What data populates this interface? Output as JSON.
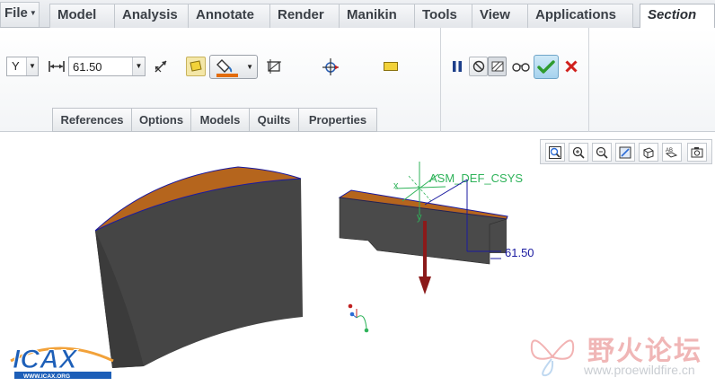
{
  "menu": {
    "file_label": "File",
    "tabs": [
      "Model",
      "Analysis",
      "Annotate",
      "Render",
      "Manikin",
      "Tools",
      "View",
      "Applications"
    ],
    "active_tab": "Section"
  },
  "ribbon": {
    "direction_value": "Y",
    "offset_value": "61.50",
    "subtabs": [
      "References",
      "Options",
      "Models",
      "Quilts",
      "Properties"
    ]
  },
  "icons": {
    "flip": "flip-direction-icon",
    "cap_color": "cap-color-icon",
    "fill_color": "fill-color-icon",
    "hatch": "hatch-icon",
    "drag_handle": "drag-handle-icon",
    "preview": "preview-icon",
    "pause": "pause-icon",
    "no_preview": "no-preview-icon",
    "verify": "verify-glasses-icon",
    "ok": "check-icon",
    "cancel": "close-icon"
  },
  "colors": {
    "cap": "#b5651d",
    "solid": "#4a4a4a",
    "csys": "#2fb35a",
    "handle": "#8b1a1a",
    "dimension": "#1a1aa0",
    "ok_check": "#2e9b2e",
    "cancel_x": "#d0201c"
  },
  "viewport": {
    "csys_label": "ASM_DEF_CSYS",
    "csys_axis_x": "x",
    "csys_axis_y": "y",
    "dimension_label": "61.50",
    "view_toolbar": [
      "refit-icon",
      "zoom-in-icon",
      "zoom-out-icon",
      "repaint-icon",
      "display-style-icon",
      "named-views-icon",
      "saved-orientations-icon"
    ]
  },
  "watermarks": {
    "left_logo": "ICAX",
    "left_url": "WWW.ICAX.ORG",
    "right_cn": "野火论坛",
    "right_url": "www.proewildfire.cn"
  }
}
